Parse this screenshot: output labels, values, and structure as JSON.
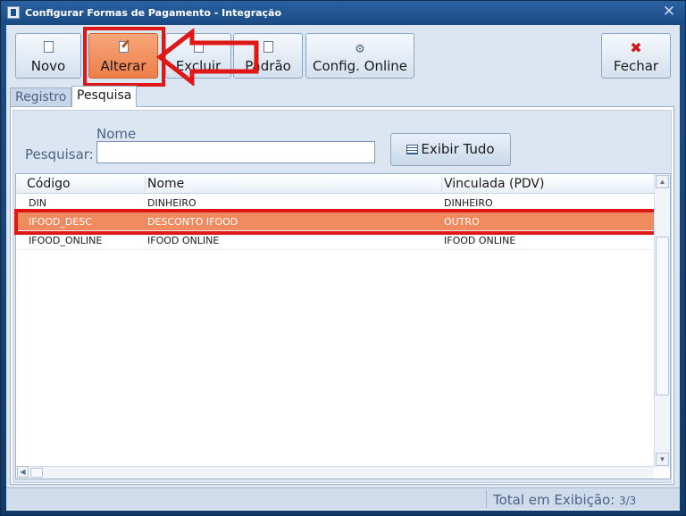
{
  "window": {
    "title": "Configurar Formas de Pagamento - Integração",
    "close_glyph": "✕"
  },
  "toolbar": {
    "buttons": [
      {
        "label": "Novo",
        "icon": "new-document-icon"
      },
      {
        "label": "Alterar",
        "icon": "edit-icon"
      },
      {
        "label": "Excluir",
        "icon": "delete-icon"
      },
      {
        "label": "Padrão",
        "icon": "default-icon"
      },
      {
        "label": "Config. Online",
        "icon": "gear-icon"
      },
      {
        "label": "Fechar",
        "icon": "close-red-x-icon"
      }
    ]
  },
  "tabs": [
    {
      "label": "Registro"
    },
    {
      "label": "Pesquisa",
      "selected": true
    }
  ],
  "search": {
    "column_label": "Nome",
    "label": "Pesquisar:",
    "value": "",
    "show_all_label": "Exibir Tudo"
  },
  "grid": {
    "columns": [
      "Código",
      "Nome",
      "Vinculada (PDV)"
    ],
    "rows": [
      {
        "codigo": "DIN",
        "nome": "DINHEIRO",
        "vinculada": "DINHEIRO",
        "selected": false
      },
      {
        "codigo": "IFOOD_DESC",
        "nome": "DESCONTO IFOOD",
        "vinculada": "OUTRO",
        "selected": true
      },
      {
        "codigo": "IFOOD_ONLINE",
        "nome": "IFOOD ONLINE",
        "vinculada": "IFOOD ONLINE",
        "selected": false
      }
    ]
  },
  "status": {
    "label": "Total em Exibição:",
    "value": "3/3"
  },
  "colors": {
    "selected_row": "#f08b5f",
    "highlight_annotation": "#e01717",
    "active_button": "#ee7e4a"
  }
}
